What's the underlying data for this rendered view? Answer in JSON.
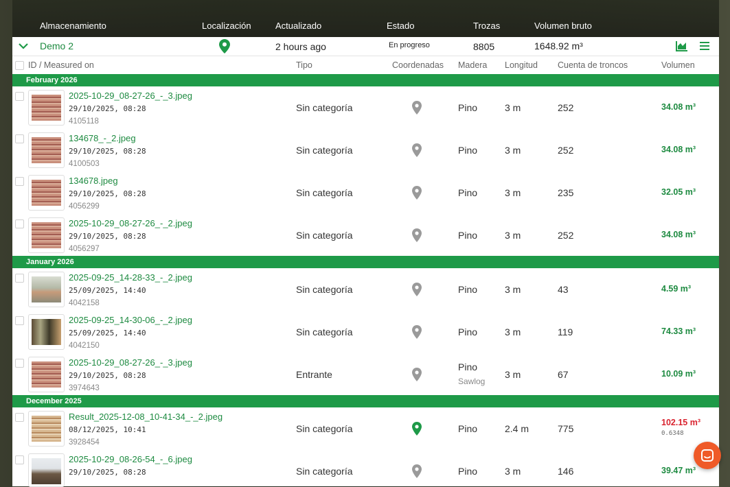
{
  "columns": {
    "storage": "Almacenamiento",
    "location": "Localización",
    "updated": "Actualizado",
    "status": "Estado",
    "logs": "Trozas",
    "gross_volume": "Volumen bruto"
  },
  "storage": {
    "name": "Demo 2",
    "updated": "2 hours ago",
    "status": "En progreso",
    "logs": "8805",
    "volume": "1648.92 m³",
    "accent": "#1e9a48"
  },
  "table_header": {
    "id": "ID / Measured on",
    "tipo": "Tipo",
    "coords": "Coordenadas",
    "madera": "Madera",
    "longitud": "Longitud",
    "cuenta": "Cuenta de troncos",
    "volumen": "Volumen"
  },
  "groups": [
    "February 2026",
    "January 2026",
    "December 2025"
  ],
  "rows": [
    {
      "file": "2025-10-29_08-27-26_-_3.jpeg",
      "date": "29/10/2025, 08:28",
      "id": "4105118",
      "tipo": "Sin categoría",
      "madera": "Pino",
      "madera2": "",
      "long": "3 m",
      "count": "252",
      "vol": "34.08 m³",
      "vol_sub": ""
    },
    {
      "file": "134678_-_2.jpeg",
      "date": "29/10/2025, 08:28",
      "id": "4100503",
      "tipo": "Sin categoría",
      "madera": "Pino",
      "madera2": "",
      "long": "3 m",
      "count": "252",
      "vol": "34.08 m³",
      "vol_sub": ""
    },
    {
      "file": "134678.jpeg",
      "date": "29/10/2025, 08:28",
      "id": "4056299",
      "tipo": "Sin categoría",
      "madera": "Pino",
      "madera2": "",
      "long": "3 m",
      "count": "235",
      "vol": "32.05 m³",
      "vol_sub": ""
    },
    {
      "file": "2025-10-29_08-27-26_-_2.jpeg",
      "date": "29/10/2025, 08:28",
      "id": "4056297",
      "tipo": "Sin categoría",
      "madera": "Pino",
      "madera2": "",
      "long": "3 m",
      "count": "252",
      "vol": "34.08 m³",
      "vol_sub": ""
    },
    {
      "file": "2025-09-25_14-28-33_-_2.jpeg",
      "date": "25/09/2025, 14:40",
      "id": "4042158",
      "tipo": "Sin categoría",
      "madera": "Pino",
      "madera2": "",
      "long": "3 m",
      "count": "43",
      "vol": "4.59 m³",
      "vol_sub": ""
    },
    {
      "file": "2025-09-25_14-30-06_-_2.jpeg",
      "date": "25/09/2025, 14:40",
      "id": "4042150",
      "tipo": "Sin categoría",
      "madera": "Pino",
      "madera2": "",
      "long": "3 m",
      "count": "119",
      "vol": "74.33 m³",
      "vol_sub": ""
    },
    {
      "file": "2025-10-29_08-27-26_-_3.jpeg",
      "date": "29/10/2025, 08:28",
      "id": "3974643",
      "tipo": "Entrante",
      "madera": "Pino",
      "madera2": "Sawlog",
      "long": "3 m",
      "count": "67",
      "vol": "10.09 m³",
      "vol_sub": ""
    },
    {
      "file": "Result_2025-12-08_10-41-34_-_2.jpeg",
      "date": "08/12/2025, 10:41",
      "id": "3928454",
      "tipo": "Sin categoría",
      "madera": "Pino",
      "madera2": "",
      "long": "2.4 m",
      "count": "775",
      "vol": "102.15 m³",
      "vol_sub": "0.6348"
    },
    {
      "file": "2025-10-29_08-26-54_-_6.jpeg",
      "date": "29/10/2025, 08:28",
      "id": "",
      "tipo": "Sin categoría",
      "madera": "Pino",
      "madera2": "",
      "long": "3 m",
      "count": "146",
      "vol": "39.47 m³",
      "vol_sub": ""
    }
  ]
}
